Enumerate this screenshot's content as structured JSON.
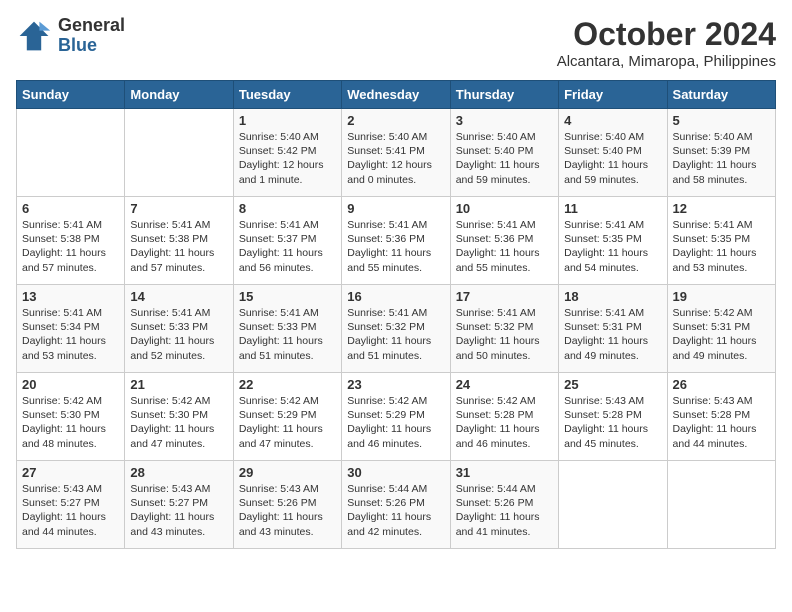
{
  "logo": {
    "general": "General",
    "blue": "Blue"
  },
  "title": "October 2024",
  "location": "Alcantara, Mimaropa, Philippines",
  "weekdays": [
    "Sunday",
    "Monday",
    "Tuesday",
    "Wednesday",
    "Thursday",
    "Friday",
    "Saturday"
  ],
  "weeks": [
    [
      {
        "day": "",
        "detail": ""
      },
      {
        "day": "",
        "detail": ""
      },
      {
        "day": "1",
        "detail": "Sunrise: 5:40 AM\nSunset: 5:42 PM\nDaylight: 12 hours\nand 1 minute."
      },
      {
        "day": "2",
        "detail": "Sunrise: 5:40 AM\nSunset: 5:41 PM\nDaylight: 12 hours\nand 0 minutes."
      },
      {
        "day": "3",
        "detail": "Sunrise: 5:40 AM\nSunset: 5:40 PM\nDaylight: 11 hours\nand 59 minutes."
      },
      {
        "day": "4",
        "detail": "Sunrise: 5:40 AM\nSunset: 5:40 PM\nDaylight: 11 hours\nand 59 minutes."
      },
      {
        "day": "5",
        "detail": "Sunrise: 5:40 AM\nSunset: 5:39 PM\nDaylight: 11 hours\nand 58 minutes."
      }
    ],
    [
      {
        "day": "6",
        "detail": "Sunrise: 5:41 AM\nSunset: 5:38 PM\nDaylight: 11 hours\nand 57 minutes."
      },
      {
        "day": "7",
        "detail": "Sunrise: 5:41 AM\nSunset: 5:38 PM\nDaylight: 11 hours\nand 57 minutes."
      },
      {
        "day": "8",
        "detail": "Sunrise: 5:41 AM\nSunset: 5:37 PM\nDaylight: 11 hours\nand 56 minutes."
      },
      {
        "day": "9",
        "detail": "Sunrise: 5:41 AM\nSunset: 5:36 PM\nDaylight: 11 hours\nand 55 minutes."
      },
      {
        "day": "10",
        "detail": "Sunrise: 5:41 AM\nSunset: 5:36 PM\nDaylight: 11 hours\nand 55 minutes."
      },
      {
        "day": "11",
        "detail": "Sunrise: 5:41 AM\nSunset: 5:35 PM\nDaylight: 11 hours\nand 54 minutes."
      },
      {
        "day": "12",
        "detail": "Sunrise: 5:41 AM\nSunset: 5:35 PM\nDaylight: 11 hours\nand 53 minutes."
      }
    ],
    [
      {
        "day": "13",
        "detail": "Sunrise: 5:41 AM\nSunset: 5:34 PM\nDaylight: 11 hours\nand 53 minutes."
      },
      {
        "day": "14",
        "detail": "Sunrise: 5:41 AM\nSunset: 5:33 PM\nDaylight: 11 hours\nand 52 minutes."
      },
      {
        "day": "15",
        "detail": "Sunrise: 5:41 AM\nSunset: 5:33 PM\nDaylight: 11 hours\nand 51 minutes."
      },
      {
        "day": "16",
        "detail": "Sunrise: 5:41 AM\nSunset: 5:32 PM\nDaylight: 11 hours\nand 51 minutes."
      },
      {
        "day": "17",
        "detail": "Sunrise: 5:41 AM\nSunset: 5:32 PM\nDaylight: 11 hours\nand 50 minutes."
      },
      {
        "day": "18",
        "detail": "Sunrise: 5:41 AM\nSunset: 5:31 PM\nDaylight: 11 hours\nand 49 minutes."
      },
      {
        "day": "19",
        "detail": "Sunrise: 5:42 AM\nSunset: 5:31 PM\nDaylight: 11 hours\nand 49 minutes."
      }
    ],
    [
      {
        "day": "20",
        "detail": "Sunrise: 5:42 AM\nSunset: 5:30 PM\nDaylight: 11 hours\nand 48 minutes."
      },
      {
        "day": "21",
        "detail": "Sunrise: 5:42 AM\nSunset: 5:30 PM\nDaylight: 11 hours\nand 47 minutes."
      },
      {
        "day": "22",
        "detail": "Sunrise: 5:42 AM\nSunset: 5:29 PM\nDaylight: 11 hours\nand 47 minutes."
      },
      {
        "day": "23",
        "detail": "Sunrise: 5:42 AM\nSunset: 5:29 PM\nDaylight: 11 hours\nand 46 minutes."
      },
      {
        "day": "24",
        "detail": "Sunrise: 5:42 AM\nSunset: 5:28 PM\nDaylight: 11 hours\nand 46 minutes."
      },
      {
        "day": "25",
        "detail": "Sunrise: 5:43 AM\nSunset: 5:28 PM\nDaylight: 11 hours\nand 45 minutes."
      },
      {
        "day": "26",
        "detail": "Sunrise: 5:43 AM\nSunset: 5:28 PM\nDaylight: 11 hours\nand 44 minutes."
      }
    ],
    [
      {
        "day": "27",
        "detail": "Sunrise: 5:43 AM\nSunset: 5:27 PM\nDaylight: 11 hours\nand 44 minutes."
      },
      {
        "day": "28",
        "detail": "Sunrise: 5:43 AM\nSunset: 5:27 PM\nDaylight: 11 hours\nand 43 minutes."
      },
      {
        "day": "29",
        "detail": "Sunrise: 5:43 AM\nSunset: 5:26 PM\nDaylight: 11 hours\nand 43 minutes."
      },
      {
        "day": "30",
        "detail": "Sunrise: 5:44 AM\nSunset: 5:26 PM\nDaylight: 11 hours\nand 42 minutes."
      },
      {
        "day": "31",
        "detail": "Sunrise: 5:44 AM\nSunset: 5:26 PM\nDaylight: 11 hours\nand 41 minutes."
      },
      {
        "day": "",
        "detail": ""
      },
      {
        "day": "",
        "detail": ""
      }
    ]
  ]
}
